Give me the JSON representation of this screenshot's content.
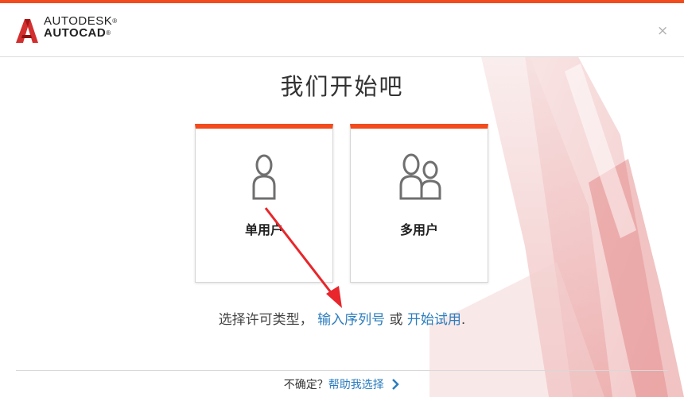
{
  "header": {
    "brand_line1": "AUTODESK",
    "brand_mark": "®",
    "brand_line2": "AUTOCAD",
    "brand_line2_mark": "®",
    "close_label": "×",
    "logo_icon": "autocad-a-logo-icon"
  },
  "main": {
    "title": "我们开始吧",
    "cards": [
      {
        "label": "单用户",
        "icon": "single-user-icon"
      },
      {
        "label": "多用户",
        "icon": "multi-user-icon"
      }
    ],
    "license": {
      "prefix": "选择许可类型，",
      "serial_link": "输入序列号",
      "middle": "或",
      "trial_link": "开始试用",
      "suffix": "."
    }
  },
  "footer": {
    "question": "不确定？",
    "help_link": "帮助我选择",
    "chevron_icon": "chevron-right-icon"
  },
  "colors": {
    "accent": "#f24b1d",
    "link": "#2b7dbf",
    "annotation_arrow": "#e8262b"
  }
}
